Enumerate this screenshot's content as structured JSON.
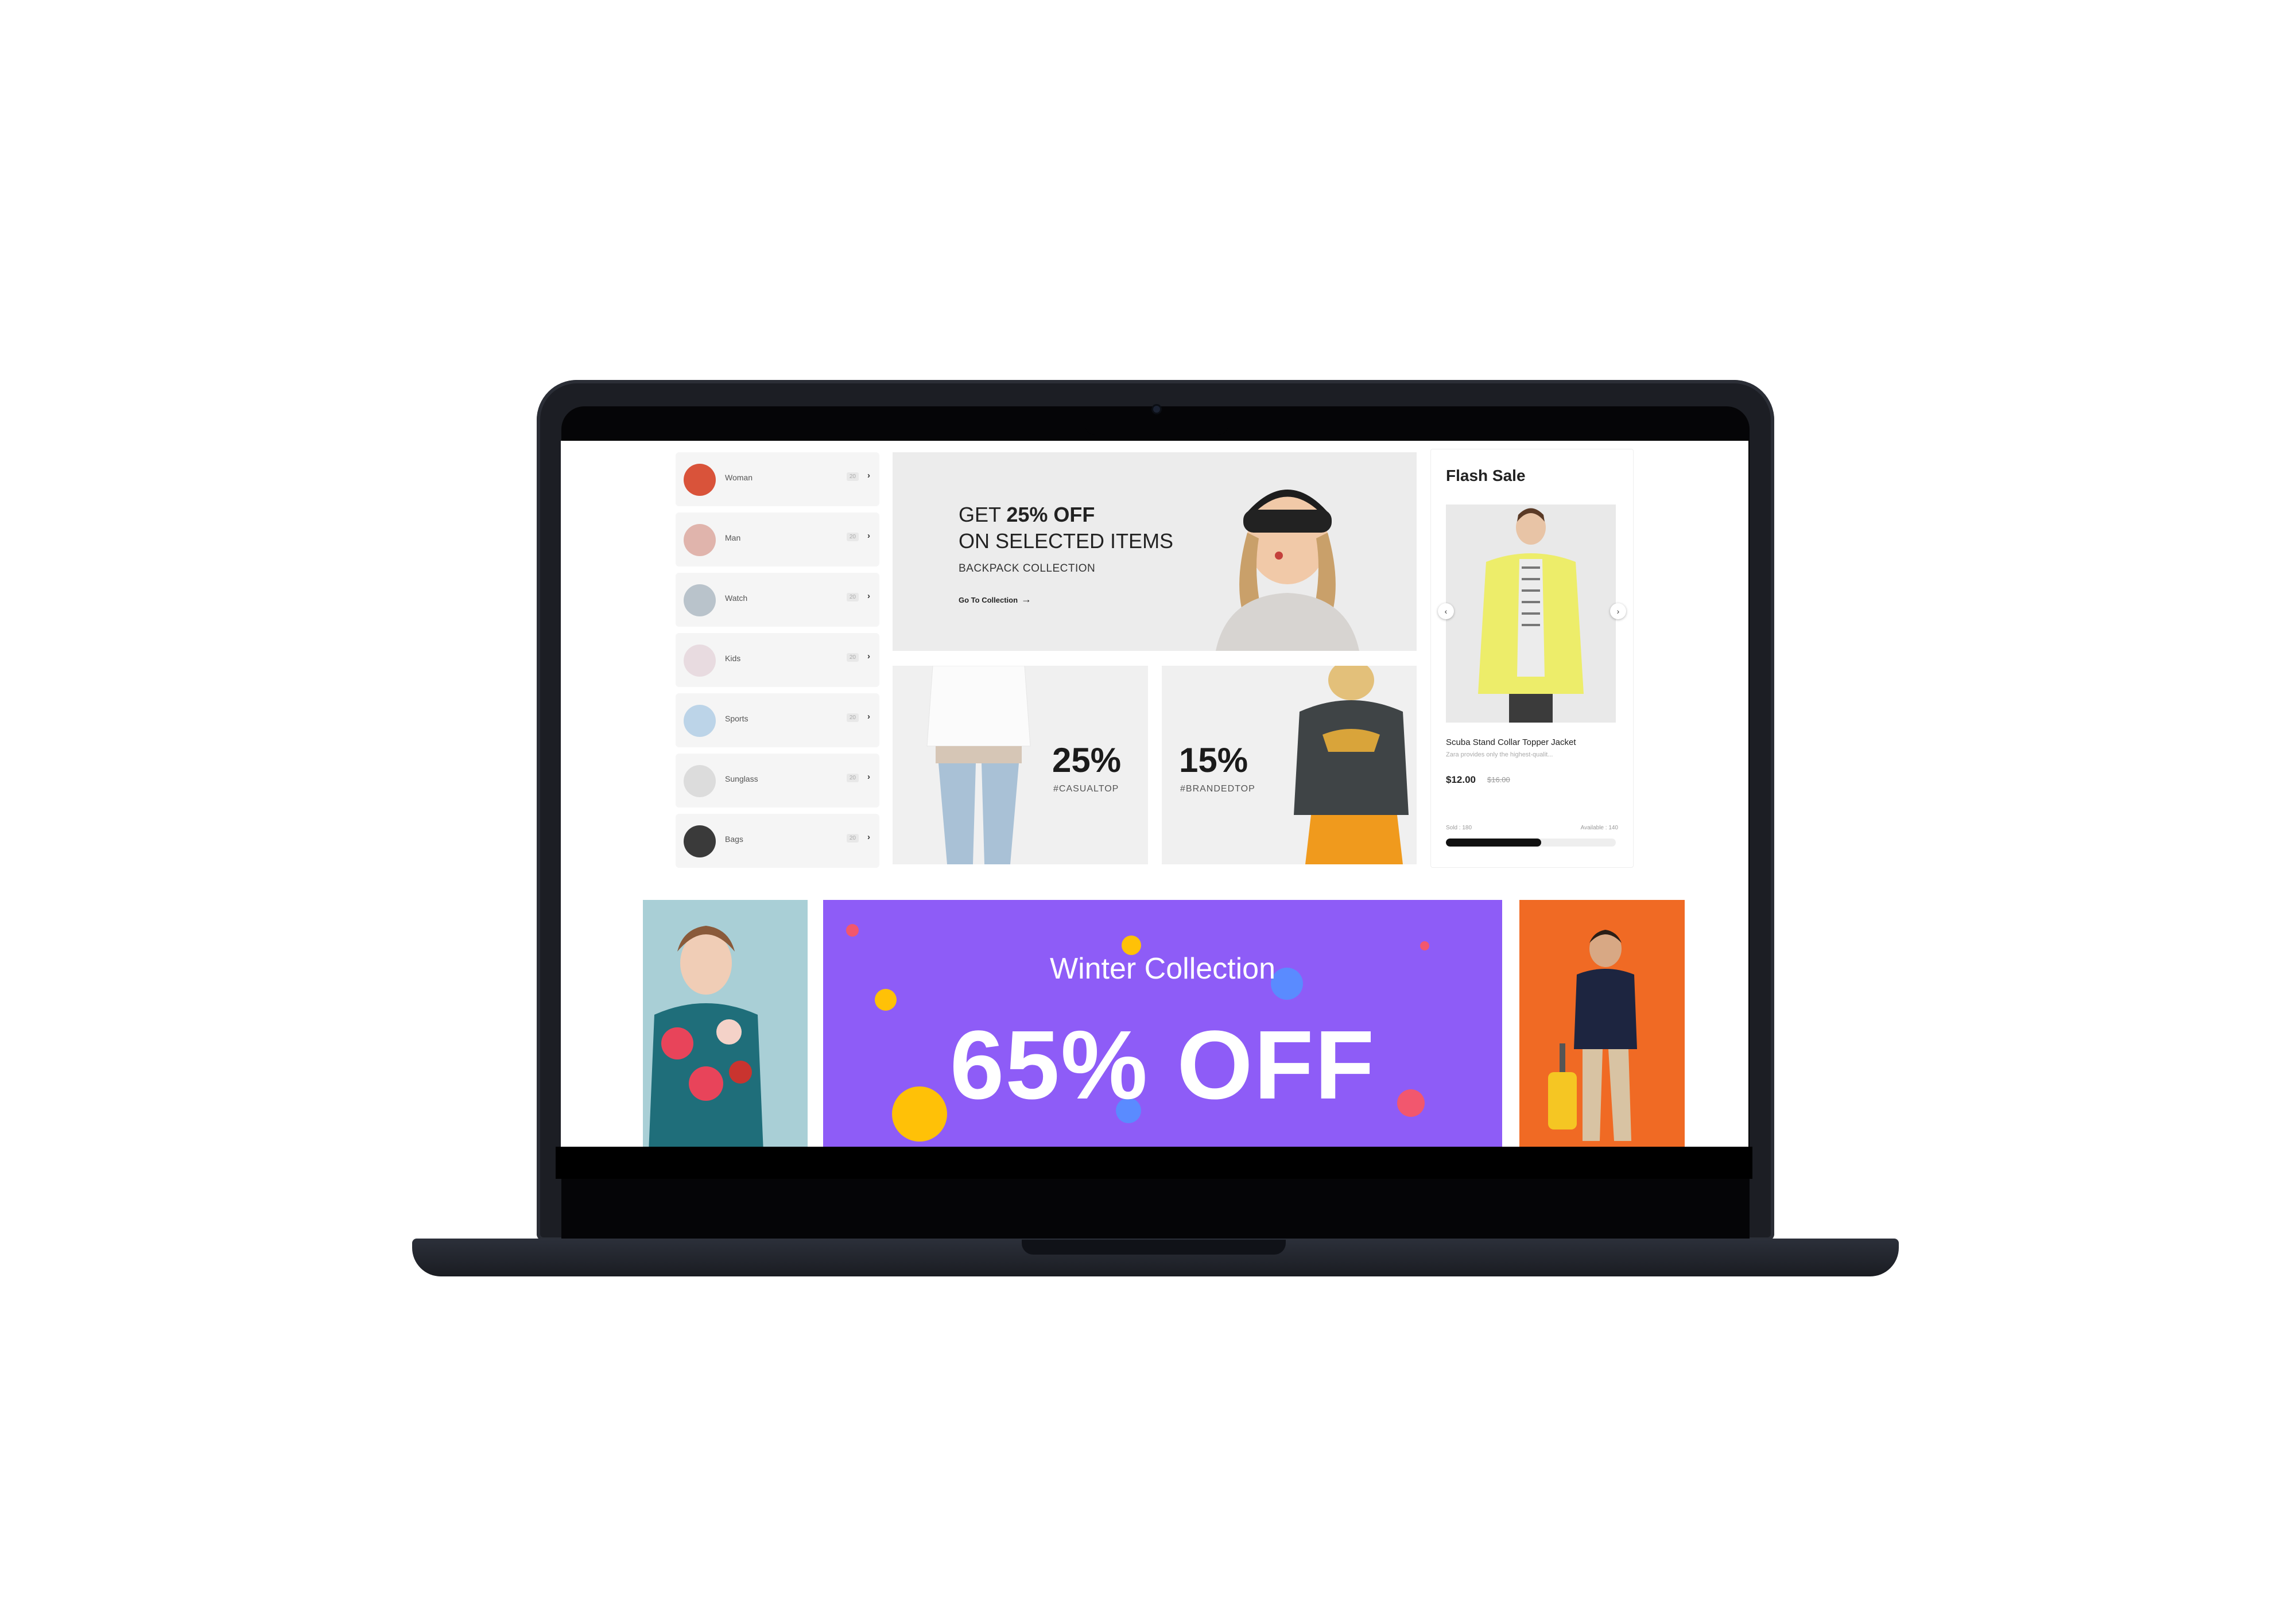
{
  "categories": [
    {
      "label": "Woman",
      "count": "20"
    },
    {
      "label": "Man",
      "count": "20"
    },
    {
      "label": "Watch",
      "count": "20"
    },
    {
      "label": "Kids",
      "count": "20"
    },
    {
      "label": "Sports",
      "count": "20"
    },
    {
      "label": "Sunglass",
      "count": "20"
    },
    {
      "label": "Bags",
      "count": "20"
    }
  ],
  "hero": {
    "line1_prefix": "GET",
    "line1_bold": "25% OFF",
    "line2": "ON SELECTED ITEMS",
    "line3": "BACKPACK COLLECTION",
    "link": "Go To Collection"
  },
  "promos": [
    {
      "percent": "25%",
      "tag": "#CASUALTOP"
    },
    {
      "percent": "15%",
      "tag": "#BRANDEDTOP"
    }
  ],
  "flash_sale": {
    "title": "Flash Sale",
    "product_name": "Scuba Stand Collar Topper Jacket",
    "description": "Zara provides only the highest-qualit...",
    "price": "$12.00",
    "old_price": "$16.00",
    "sold": "Sold : 180",
    "available": "Available : 140",
    "sold_fraction": 0.56
  },
  "winter_banner": {
    "subtitle": "Winter Collection",
    "headline": "65% OFF"
  },
  "colors": {
    "banner_purple": "#8e5cf7",
    "accent_orange": "#f06a24",
    "accent_teal": "#a9cfd6"
  }
}
